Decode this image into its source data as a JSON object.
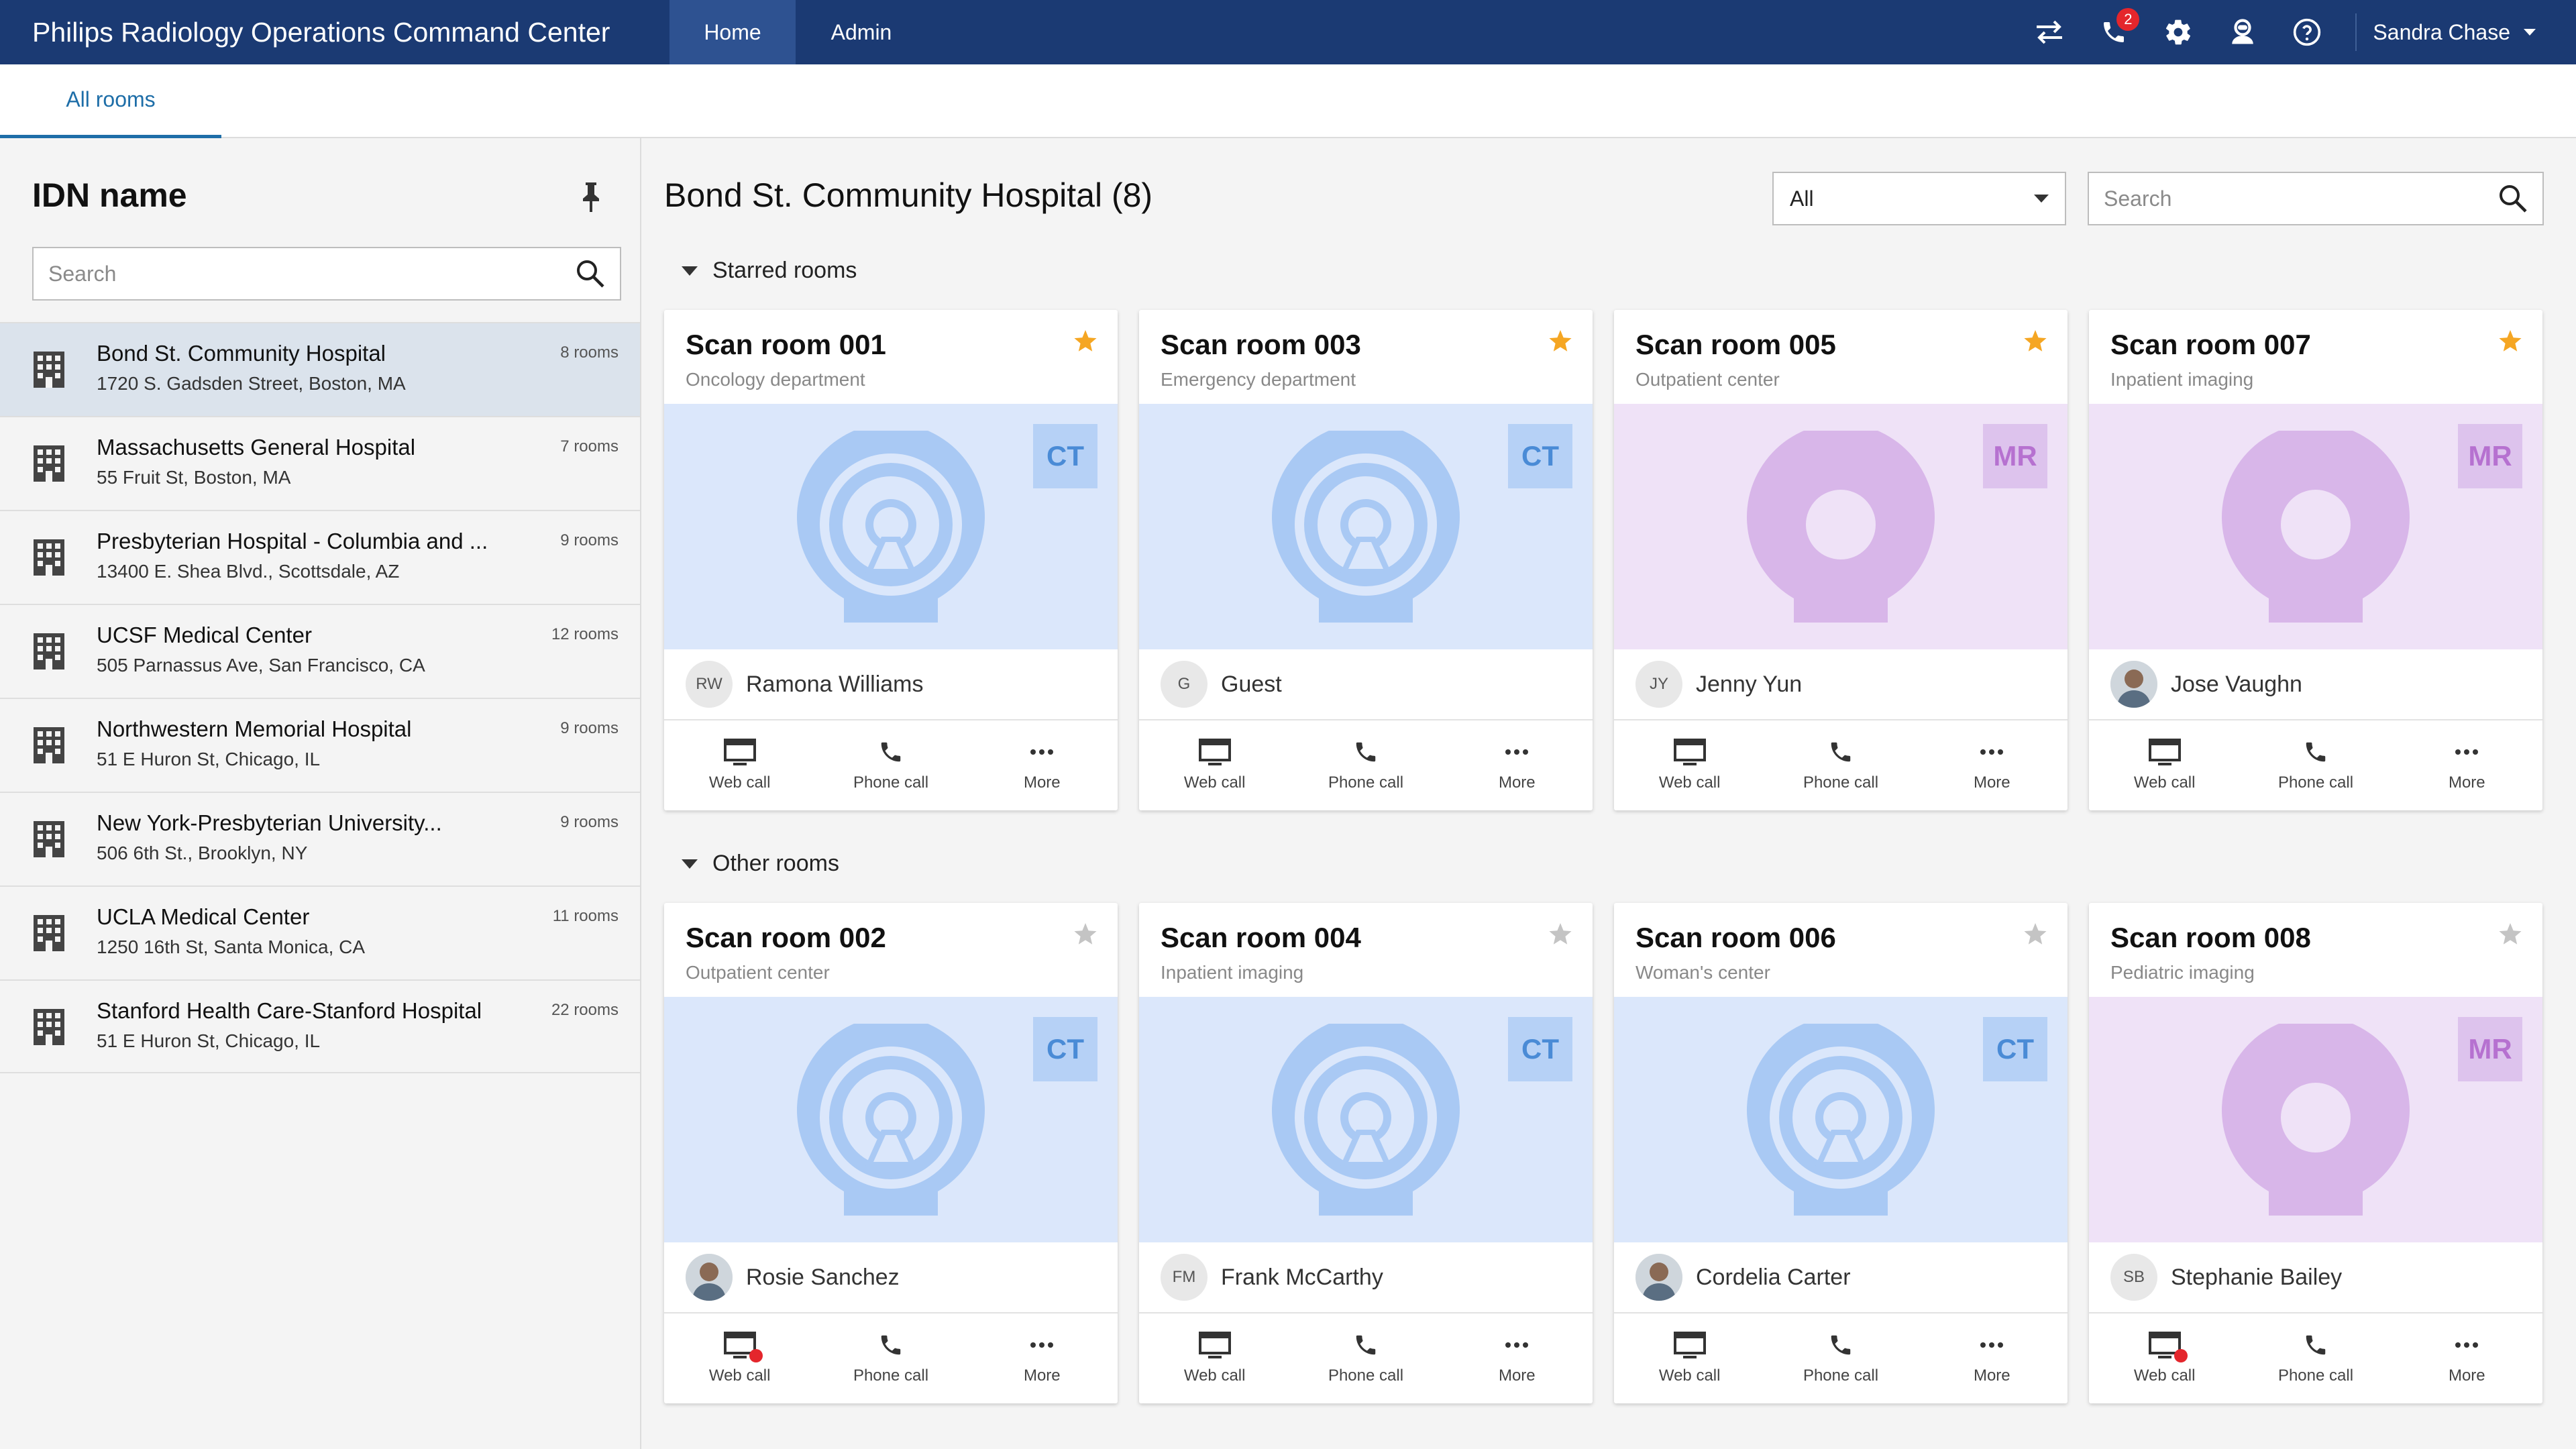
{
  "header": {
    "app_title": "Philips Radiology Operations Command Center",
    "nav": [
      {
        "label": "Home",
        "active": true
      },
      {
        "label": "Admin",
        "active": false
      }
    ],
    "icons": [
      "transfer-icon",
      "phone-icon",
      "gear-icon",
      "agent-icon",
      "help-icon"
    ],
    "phone_badge": "2",
    "user_name": "Sandra Chase"
  },
  "tabs": {
    "all_rooms": "All rooms"
  },
  "sidebar": {
    "title": "IDN name",
    "search_placeholder": "Search",
    "hospitals": [
      {
        "name": "Bond St. Community Hospital",
        "address": "1720 S. Gadsden Street, Boston, MA",
        "count": "8 rooms",
        "selected": true
      },
      {
        "name": "Massachusetts General Hospital",
        "address": "55 Fruit St, Boston, MA",
        "count": "7 rooms"
      },
      {
        "name": "Presbyterian Hospital - Columbia and ...",
        "address": "13400 E. Shea Blvd., Scottsdale, AZ",
        "count": "9 rooms"
      },
      {
        "name": "UCSF Medical Center",
        "address": "505 Parnassus Ave, San Francisco, CA",
        "count": "12 rooms"
      },
      {
        "name": "Northwestern Memorial Hospital",
        "address": "51 E Huron St, Chicago, IL",
        "count": "9 rooms"
      },
      {
        "name": "New York-Presbyterian University...",
        "address": "506 6th St., Brooklyn, NY",
        "count": "9 rooms"
      },
      {
        "name": "UCLA Medical Center",
        "address": "1250 16th St, Santa Monica, CA",
        "count": "11 rooms"
      },
      {
        "name": "Stanford Health Care-Stanford Hospital",
        "address": "51 E Huron St, Chicago, IL",
        "count": "22 rooms"
      }
    ]
  },
  "main": {
    "title": "Bond St. Community Hospital (8)",
    "filter_value": "All",
    "search_placeholder": "Search",
    "starred_heading": "Starred rooms",
    "other_heading": "Other rooms",
    "action_labels": {
      "web_call": "Web call",
      "phone_call": "Phone call",
      "more": "More"
    },
    "starred_rooms": [
      {
        "title": "Scan room 001",
        "dept": "Oncology department",
        "modality": "CT",
        "person": "Ramona Williams",
        "initials": "RW",
        "starred": true
      },
      {
        "title": "Scan room 003",
        "dept": "Emergency department",
        "modality": "CT",
        "person": "Guest",
        "initials": "G",
        "starred": true
      },
      {
        "title": "Scan room 005",
        "dept": "Outpatient center",
        "modality": "MR",
        "person": "Jenny Yun",
        "initials": "JY",
        "starred": true
      },
      {
        "title": "Scan room 007",
        "dept": "Inpatient imaging",
        "modality": "MR",
        "person": "Jose Vaughn",
        "initials": "",
        "starred": true
      }
    ],
    "other_rooms": [
      {
        "title": "Scan room 002",
        "dept": "Outpatient center",
        "modality": "CT",
        "person": "Rosie Sanchez",
        "initials": "",
        "starred": false,
        "web_call_alert": true
      },
      {
        "title": "Scan room 004",
        "dept": "Inpatient imaging",
        "modality": "CT",
        "person": "Frank McCarthy",
        "initials": "FM",
        "starred": false
      },
      {
        "title": "Scan room 006",
        "dept": "Woman's center",
        "modality": "CT",
        "person": "Cordelia Carter",
        "initials": "",
        "starred": false
      },
      {
        "title": "Scan room 008",
        "dept": "Pediatric imaging",
        "modality": "MR",
        "person": "Stephanie Bailey",
        "initials": "SB",
        "starred": false,
        "web_call_alert": true
      }
    ]
  },
  "colors": {
    "header_bg": "#1b3a73",
    "active_tab": "#2e5291",
    "accent": "#1e6ea8",
    "star": "#f5a623",
    "ct": "#dbe7fb",
    "mr": "#efe2f7",
    "alert": "#e4262c"
  }
}
